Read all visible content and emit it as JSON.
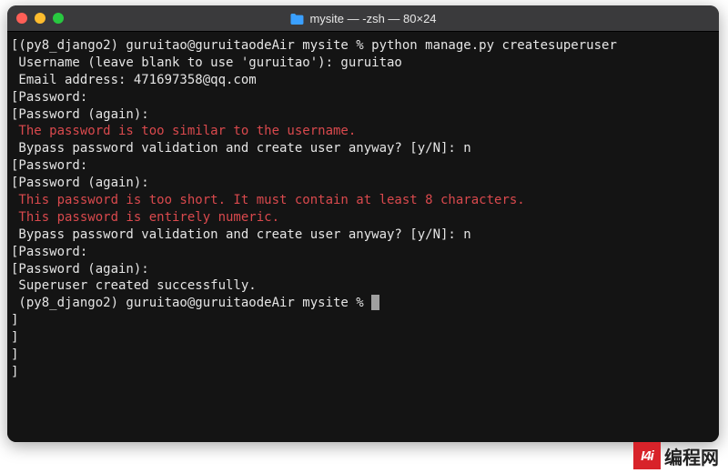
{
  "window": {
    "title": "mysite — -zsh — 80×24",
    "traffic": {
      "close": "#ff5f57",
      "min": "#febc2e",
      "max": "#28c840"
    }
  },
  "lines": [
    {
      "text": "[(py8_django2) guruitao@guruitaodeAir mysite % python manage.py createsuperuser",
      "cls": ""
    },
    {
      "text": " Username (leave blank to use 'guruitao'): guruitao",
      "cls": ""
    },
    {
      "text": " Email address: 471697358@qq.com",
      "cls": ""
    },
    {
      "text": "[Password:",
      "cls": ""
    },
    {
      "text": "[Password (again):",
      "cls": ""
    },
    {
      "text": " The password is too similar to the username.",
      "cls": "warn"
    },
    {
      "text": " Bypass password validation and create user anyway? [y/N]: n",
      "cls": ""
    },
    {
      "text": "[Password:",
      "cls": ""
    },
    {
      "text": "[Password (again):",
      "cls": ""
    },
    {
      "text": " This password is too short. It must contain at least 8 characters.",
      "cls": "warn"
    },
    {
      "text": " This password is entirely numeric.",
      "cls": "warn"
    },
    {
      "text": " Bypass password validation and create user anyway? [y/N]: n",
      "cls": ""
    },
    {
      "text": "[Password:",
      "cls": ""
    },
    {
      "text": "[Password (again):",
      "cls": ""
    },
    {
      "text": " Superuser created successfully.",
      "cls": ""
    },
    {
      "text": " (py8_django2) guruitao@guruitaodeAir mysite % ",
      "cls": "",
      "cursor": true
    },
    {
      "text": "]",
      "cls": ""
    },
    {
      "text": "]",
      "cls": ""
    },
    {
      "text": "]",
      "cls": ""
    },
    {
      "text": "]",
      "cls": ""
    }
  ],
  "watermark": {
    "badge": "I4i",
    "text": "编程网"
  }
}
